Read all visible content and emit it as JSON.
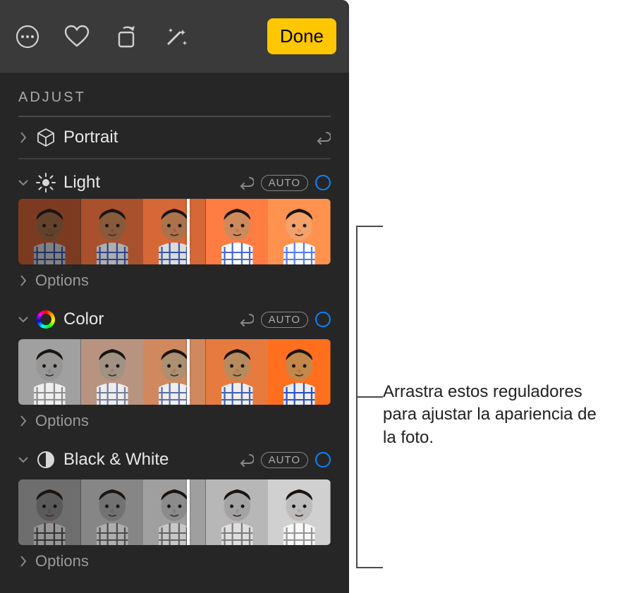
{
  "toolbar": {
    "done_label": "Done"
  },
  "adjust": {
    "title": "ADJUST",
    "portrait": {
      "label": "Portrait"
    },
    "light": {
      "label": "Light",
      "auto": "AUTO",
      "options": "Options"
    },
    "color": {
      "label": "Color",
      "auto": "AUTO",
      "options": "Options"
    },
    "bw": {
      "label": "Black & White",
      "auto": "AUTO",
      "options": "Options"
    }
  },
  "callout": {
    "text": "Arrastra estos reguladores para ajustar la apariencia de la foto."
  }
}
